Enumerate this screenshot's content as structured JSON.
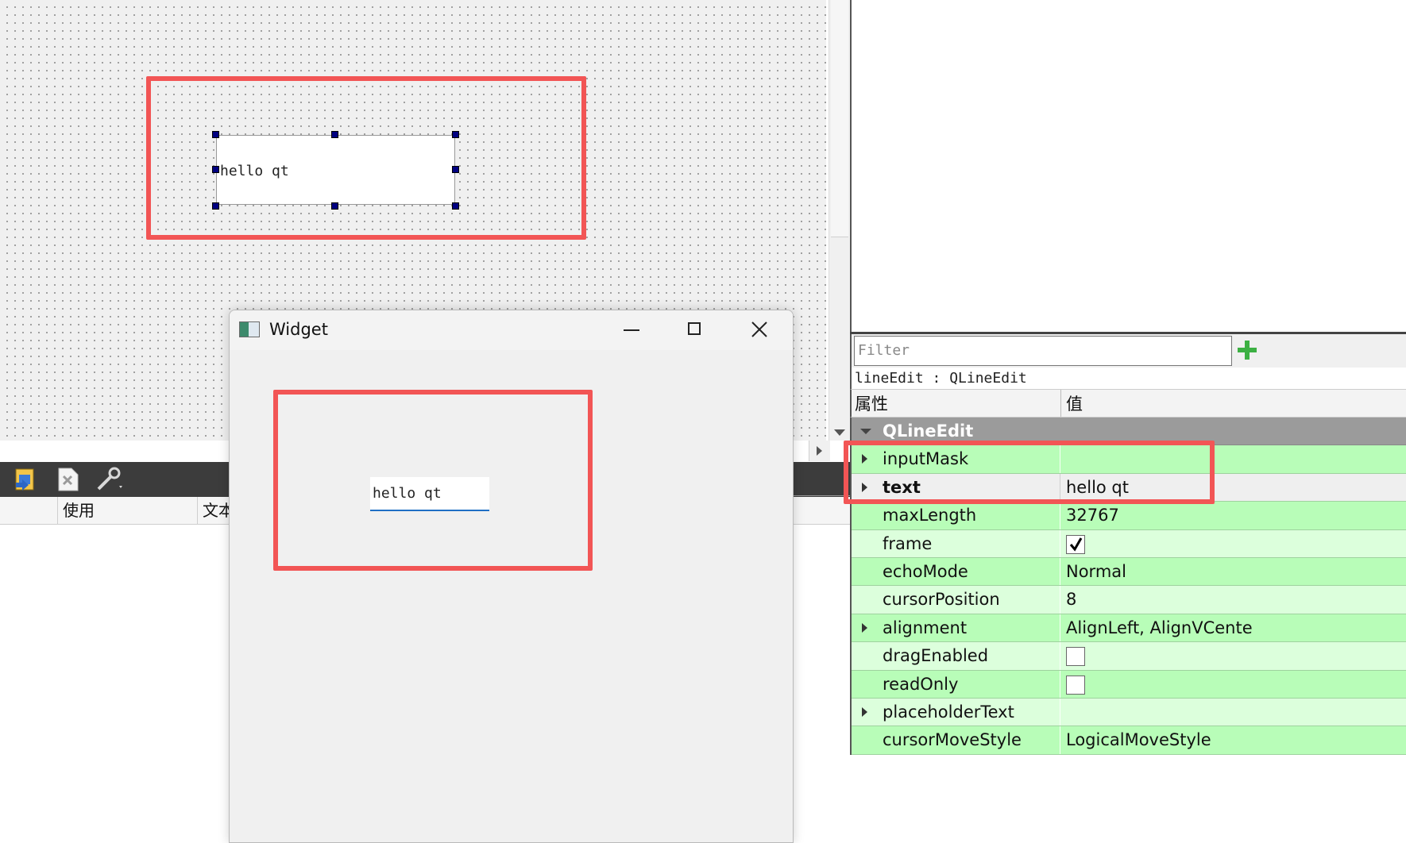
{
  "designer": {
    "lineedit_text": "hello qt"
  },
  "bottom_panel": {
    "toolbar": {
      "icons": [
        "new-action-icon",
        "delete-action-icon",
        "configure-icon"
      ]
    },
    "columns": [
      "使用",
      "文本"
    ]
  },
  "widget_window": {
    "title": "Widget",
    "lineedit_text": "hello qt"
  },
  "property_editor": {
    "filter_placeholder": "Filter",
    "object_label": "lineEdit : QLineEdit",
    "header": {
      "property": "属性",
      "value": "值"
    },
    "group": "QLineEdit",
    "rows": [
      {
        "name": "inputMask",
        "value": "",
        "expandable": true
      },
      {
        "name": "text",
        "value": "hello qt",
        "expandable": true
      },
      {
        "name": "maxLength",
        "value": "32767"
      },
      {
        "name": "frame",
        "value": "checked"
      },
      {
        "name": "echoMode",
        "value": "Normal"
      },
      {
        "name": "cursorPosition",
        "value": "8"
      },
      {
        "name": "alignment",
        "value": "AlignLeft, AlignVCente",
        "expandable": true
      },
      {
        "name": "dragEnabled",
        "value": "unchecked"
      },
      {
        "name": "readOnly",
        "value": "unchecked"
      },
      {
        "name": "placeholderText",
        "value": "",
        "expandable": true
      },
      {
        "name": "cursorMoveStyle",
        "value": "LogicalMoveStyle"
      }
    ]
  },
  "colors": {
    "highlight": "#f25555",
    "row_green_dark": "#b8fdb8",
    "row_green_light": "#dcffdc",
    "selection_handle": "#000080",
    "focus_underline": "#1f6fc5"
  }
}
